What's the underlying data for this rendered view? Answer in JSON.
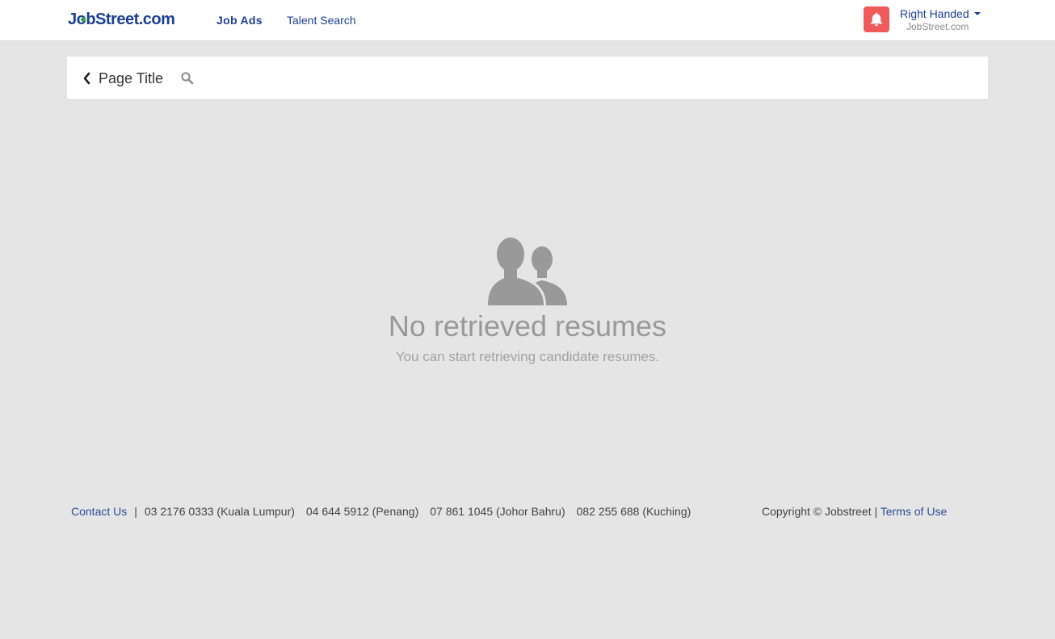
{
  "header": {
    "logo_text_a": "J",
    "logo_text_b": "o",
    "logo_text_c": "bStreet.com",
    "nav": {
      "job_ads": "Job Ads",
      "talent_search": "Talent Search"
    },
    "notification_icon": "bell-icon",
    "user": {
      "name": "Right Handed",
      "company": "JobStreet.com"
    }
  },
  "title_bar": {
    "back_icon": "chevron-left-icon",
    "title": "Page Title",
    "search_icon": "search-icon"
  },
  "empty_state": {
    "icon": "users-icon",
    "title": "No retrieved resumes",
    "subtitle": "You can start retrieving candidate resumes."
  },
  "footer": {
    "contact_label": "Contact Us",
    "separator": "|",
    "phones": [
      "03 2176 0333 (Kuala Lumpur)",
      "04 644 5912 (Penang)",
      "07 861 1045 (Johor Bahru)",
      "082 255 688 (Kuching)"
    ],
    "copyright": "Copyright © Jobstreet |",
    "terms_label": "Terms of Use"
  },
  "colors": {
    "brand": "#1c3f94",
    "notification": "#ef5b5b",
    "background": "#e5e5e5",
    "muted_text": "#999999"
  }
}
